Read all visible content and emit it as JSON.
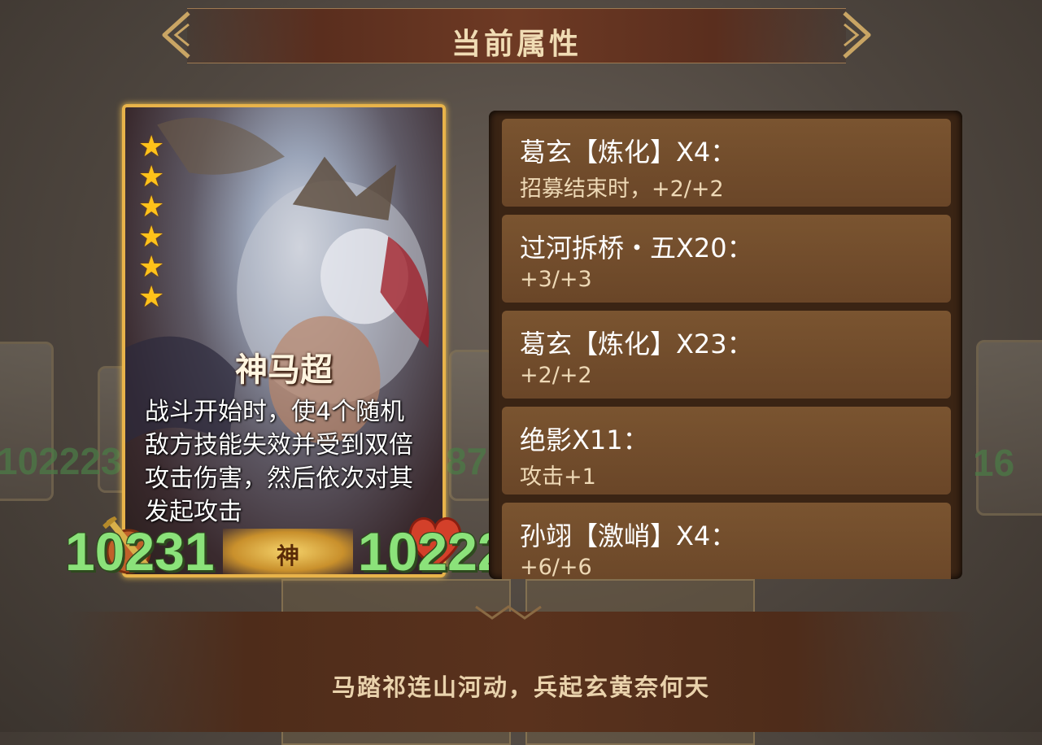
{
  "header": {
    "title": "当前属性",
    "prev_icon": "chevron-left-icon",
    "next_icon": "chevron-right-icon"
  },
  "hero": {
    "name": "神马超",
    "stars": 6,
    "star_symbol": "★",
    "description": "战斗开始时，使4个随机敌方技能失效并受到双倍攻击伤害，然后依次对其发起攻击",
    "rarity": "神",
    "attack": "10231",
    "health": "10222"
  },
  "background_cards": {
    "left_value": "102223",
    "middle_value": "87",
    "right_value": "16"
  },
  "buffs": [
    {
      "title": "葛玄【炼化】X4：",
      "effect": "招募结束时，+2/+2"
    },
    {
      "title": "过河拆桥・五X20：",
      "effect": "+3/+3"
    },
    {
      "title": "葛玄【炼化】X23：",
      "effect": "+2/+2"
    },
    {
      "title": "绝影X11：",
      "effect": "攻击+1"
    },
    {
      "title": "孙翊【激峭】X4：",
      "effect": "+6/+6"
    }
  ],
  "quote": "马踏祁连山河动，兵起玄黄奈何天",
  "colors": {
    "gold_border": "#e8b34a",
    "stat_green": "#8be27a",
    "star_yellow": "#ffc21a",
    "panel_brown": "#6a4628"
  }
}
